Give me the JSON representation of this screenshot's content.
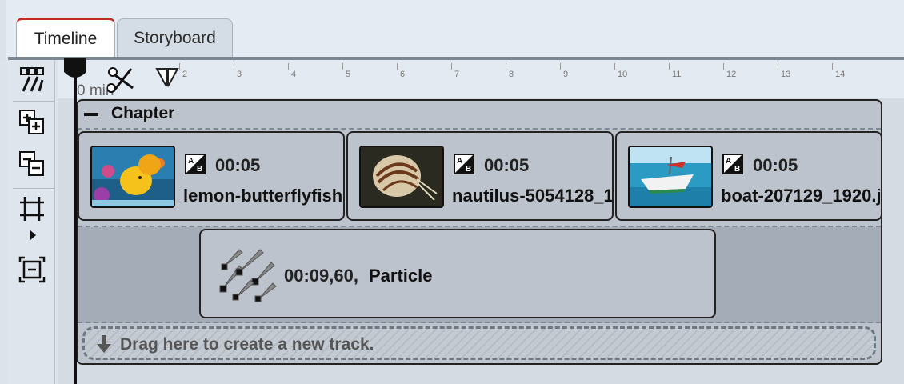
{
  "tabs": [
    {
      "label": "Timeline",
      "active": true
    },
    {
      "label": "Storyboard",
      "active": false
    }
  ],
  "ruler": {
    "unit_label": "0 min",
    "ticks": [
      "2",
      "3",
      "4",
      "5",
      "6",
      "7",
      "8",
      "9",
      "10",
      "11",
      "12",
      "13",
      "14"
    ]
  },
  "chapter": {
    "title": "Chapter"
  },
  "clips": [
    {
      "duration": "00:05",
      "name": "lemon-butterflyfish",
      "thumb": "fish-thumbnail"
    },
    {
      "duration": "00:05",
      "name": "nautilus-5054128_1",
      "thumb": "nautilus-thumbnail"
    },
    {
      "duration": "00:05",
      "name": "boat-207129_1920.j",
      "thumb": "boat-thumbnail"
    }
  ],
  "particle": {
    "duration": "00:09,60,",
    "name": "Particle"
  },
  "drop_zone": {
    "text": "Drag here to create a new track."
  },
  "colors": {
    "active_tab_accent": "#c22a24",
    "clip_background": "#bcc3cc",
    "track_background": "#a4acb7"
  }
}
